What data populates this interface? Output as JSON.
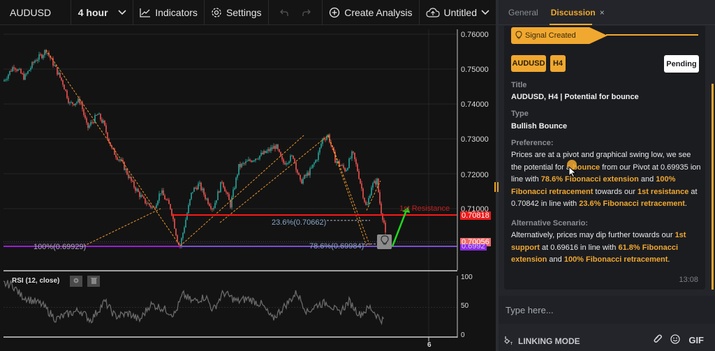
{
  "toolbar": {
    "symbol": "AUDUSD",
    "interval": "4 hour",
    "indicators_label": "Indicators",
    "settings_label": "Settings",
    "create_analysis_label": "Create Analysis",
    "layout_name": "Untitled"
  },
  "chart": {
    "price_axis": [
      "0.76000",
      "0.75000",
      "0.74000",
      "0.73000",
      "0.72000",
      "0.71000"
    ],
    "resistance_label": "1st Resistance",
    "resistance_price": "0.70818",
    "current_price": "0.70056",
    "pivot_price_partial": "0.6992",
    "fib_labels": {
      "fib_100": "100%(0.69929)",
      "fib_236": "23.6%(0.70662)",
      "fib_786": "78.6%(0.69984)"
    },
    "x_axis_label": "6",
    "colors": {
      "bull": "#26a69a",
      "bear": "#ef5350",
      "resistance": "#ff1a1a",
      "pivot": "#7b4fd6",
      "fib": "#e8962a",
      "arrow": "#1ed81e"
    }
  },
  "rsi": {
    "title": "RSI (12, close)",
    "axis": [
      "100",
      "50",
      "0"
    ]
  },
  "panel": {
    "tabs": [
      {
        "label": "General",
        "active": false
      },
      {
        "label": "Discussion",
        "active": true,
        "close": "×"
      }
    ],
    "signal_banner": "Signal Created",
    "badges": {
      "symbol": "AUDUSD",
      "timeframe": "H4"
    },
    "status_button": "Pending",
    "title_label": "Title",
    "title_value": "AUDUSD, H4 | Potential for bounce",
    "type_label": "Type",
    "type_value": "Bullish Bounce",
    "preference_label": "Preference:",
    "preference": {
      "t1": "Prices are at a pivot and graphical swing low, we see the potential for a ",
      "h1": "bounce",
      "t2": " from our Pivot at 0.69935 ion line with ",
      "h2": "78.6% Fibonacci extension",
      "t3": " and ",
      "h3": "100% Fibonacci retracement",
      "t4": " towards our ",
      "h4": "1st resistance",
      "t5": " at 0.70842 in line with ",
      "h5": "23.6% Fibonacci retracement",
      "t6": "."
    },
    "alternative_label": "Alternative Scenario:",
    "alternative": {
      "t1": "Alternatively, prices may dip further towards our ",
      "h1": "1st support",
      "t2": " at 0.69616 in line with ",
      "h2": "61.8% Fibonacci extension",
      "t3": " and ",
      "h3": "100% Fibonacci retracement",
      "t4": "."
    },
    "timestamp": "13:08",
    "composer_placeholder": "Type here...",
    "linking_mode": "LINKING MODE",
    "gif_label": "GIF"
  }
}
